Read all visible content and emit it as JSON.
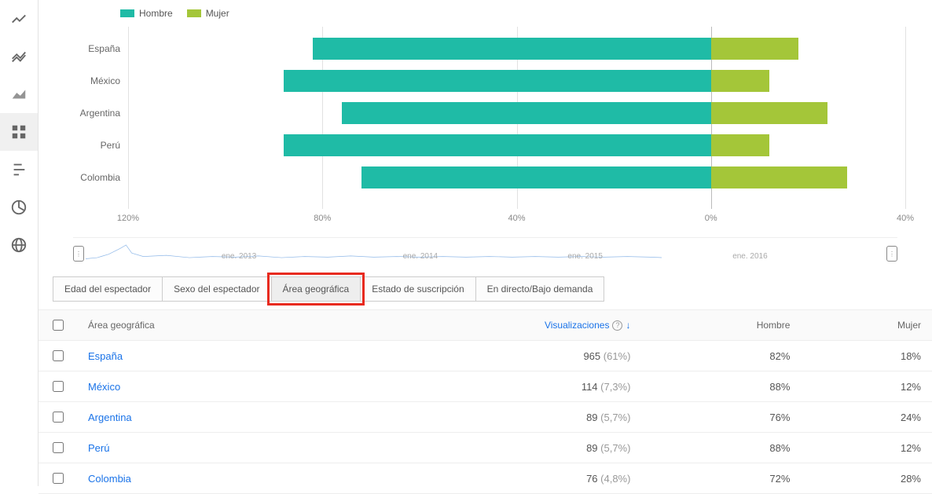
{
  "colors": {
    "male": "#1fbba6",
    "female": "#a4c639"
  },
  "legend": {
    "male": "Hombre",
    "female": "Mujer"
  },
  "sidebar": {
    "items": [
      {
        "name": "line-chart-icon"
      },
      {
        "name": "compare-chart-icon"
      },
      {
        "name": "area-chart-icon"
      },
      {
        "name": "grid-chart-icon",
        "active": true
      },
      {
        "name": "bar-chart-icon"
      },
      {
        "name": "pie-chart-icon"
      },
      {
        "name": "globe-icon"
      }
    ]
  },
  "chart_data": {
    "type": "bar",
    "orientation": "diverging-horizontal",
    "categories": [
      "España",
      "México",
      "Argentina",
      "Perú",
      "Colombia"
    ],
    "series": [
      {
        "name": "Hombre",
        "values": [
          82,
          88,
          76,
          88,
          72
        ],
        "direction": "left",
        "color": "#1fbba6"
      },
      {
        "name": "Mujer",
        "values": [
          18,
          12,
          24,
          12,
          28
        ],
        "direction": "right",
        "color": "#a4c639"
      }
    ],
    "x_ticks": [
      120,
      80,
      40,
      0,
      40
    ],
    "x_tick_labels": [
      "120%",
      "80%",
      "40%",
      "0%",
      "40%"
    ],
    "x_range_left": 120,
    "x_range_right": 40,
    "xlabel": "",
    "ylabel": "",
    "title": ""
  },
  "timeline": {
    "labels": [
      "ene. 2013",
      "ene. 2014",
      "ene. 2015",
      "ene. 2016"
    ]
  },
  "tabs": [
    {
      "label": "Edad del espectador"
    },
    {
      "label": "Sexo del espectador"
    },
    {
      "label": "Área geográfica",
      "active": true,
      "highlight": true
    },
    {
      "label": "Estado de suscripción"
    },
    {
      "label": "En directo/Bajo demanda"
    }
  ],
  "table": {
    "headers": {
      "geo": "Área geográfica",
      "views": "Visualizaciones",
      "male": "Hombre",
      "female": "Mujer"
    },
    "sort_indicator": "↓",
    "rows": [
      {
        "geo": "España",
        "views": "965",
        "views_pct": "(61%)",
        "male": "82%",
        "female": "18%"
      },
      {
        "geo": "México",
        "views": "114",
        "views_pct": "(7,3%)",
        "male": "88%",
        "female": "12%"
      },
      {
        "geo": "Argentina",
        "views": "89",
        "views_pct": "(5,7%)",
        "male": "76%",
        "female": "24%"
      },
      {
        "geo": "Perú",
        "views": "89",
        "views_pct": "(5,7%)",
        "male": "88%",
        "female": "12%"
      },
      {
        "geo": "Colombia",
        "views": "76",
        "views_pct": "(4,8%)",
        "male": "72%",
        "female": "28%"
      }
    ]
  }
}
